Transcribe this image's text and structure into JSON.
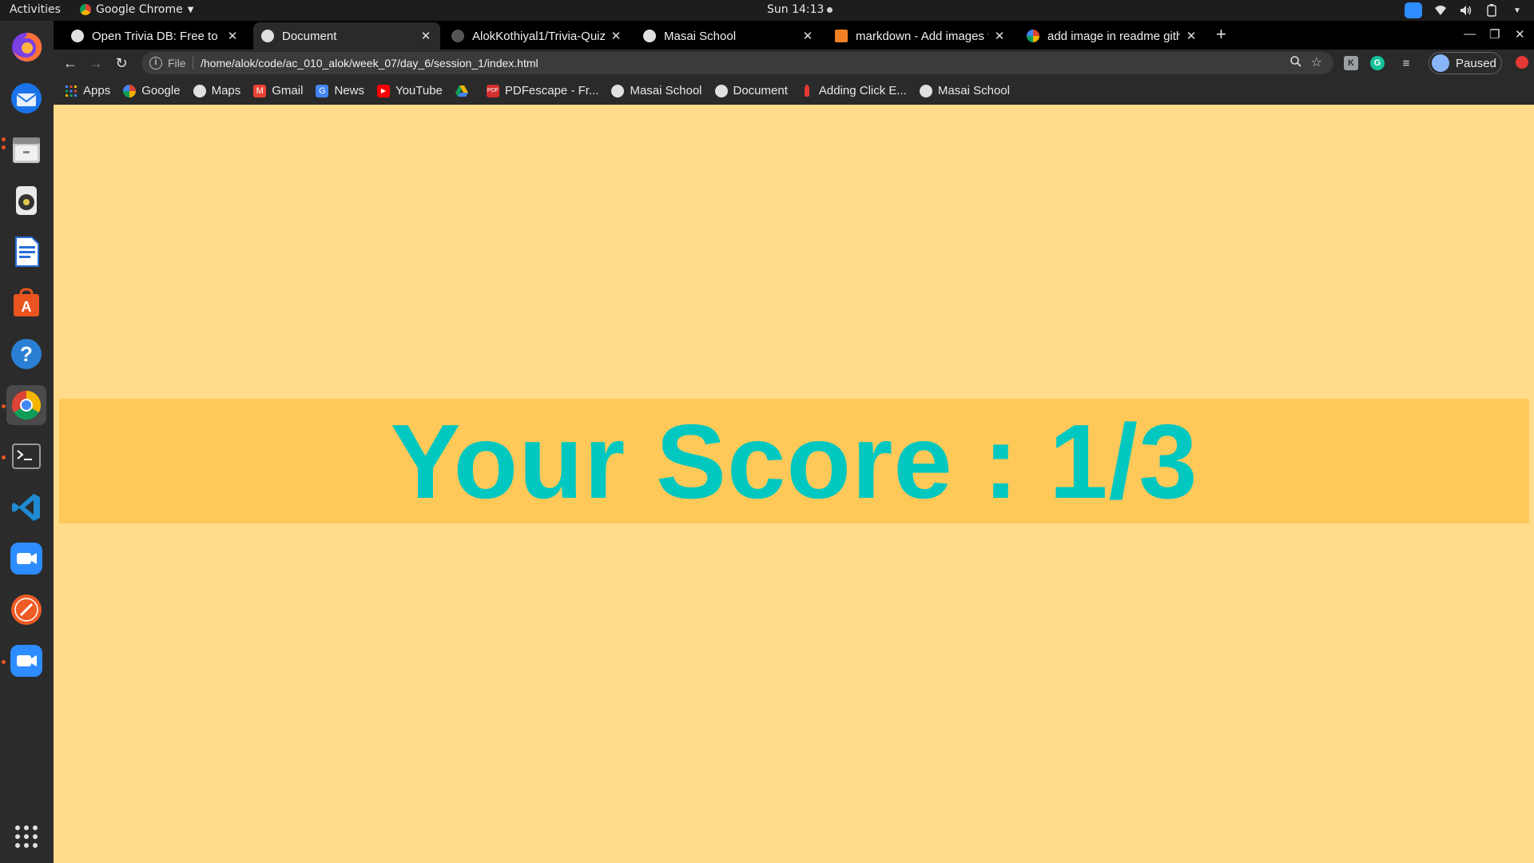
{
  "system": {
    "activities": "Activities",
    "app_name": "Google Chrome",
    "clock": "Sun 14:13"
  },
  "dock": {
    "apps": [
      "firefox-icon",
      "thunderbird-icon",
      "files-icon",
      "rhythmbox-icon",
      "libreoffice-writer-icon",
      "software-center-icon",
      "help-icon",
      "chrome-icon",
      "terminal-icon",
      "vscode-icon",
      "zoom-icon",
      "postman-icon",
      "zoom-icon"
    ]
  },
  "tabs": [
    {
      "title": "Open Trivia DB: Free to us",
      "active": false
    },
    {
      "title": "Document",
      "active": true
    },
    {
      "title": "AlokKothiyal1/Trivia-Quiz",
      "active": false
    },
    {
      "title": "Masai School",
      "active": false
    },
    {
      "title": "markdown - Add images t",
      "active": false
    },
    {
      "title": "add image in readme gith",
      "active": false
    }
  ],
  "toolbar": {
    "scheme": "File",
    "url": "/home/alok/code/ac_010_alok/week_07/day_6/session_1/index.html",
    "profile_label": "Paused"
  },
  "bookmarks": [
    {
      "label": "Apps",
      "icon": "apps-grid-icon"
    },
    {
      "label": "Google",
      "icon": "google-icon"
    },
    {
      "label": "Maps",
      "icon": "globe-icon"
    },
    {
      "label": "Gmail",
      "icon": "gmail-icon"
    },
    {
      "label": "News",
      "icon": "news-icon"
    },
    {
      "label": "YouTube",
      "icon": "youtube-icon"
    },
    {
      "label": "",
      "icon": "drive-icon"
    },
    {
      "label": "PDFescape - Fr...",
      "icon": "pdf-icon"
    },
    {
      "label": "Masai School",
      "icon": "globe-icon"
    },
    {
      "label": "Document",
      "icon": "globe-icon"
    },
    {
      "label": "Adding Click E...",
      "icon": "bookmark-icon"
    },
    {
      "label": "Masai School",
      "icon": "globe-icon"
    }
  ],
  "page": {
    "score_text": "Your Score : 1/3",
    "background": "#ffdb8a",
    "band_color": "#ffc95a",
    "text_color": "#00c8c0"
  }
}
